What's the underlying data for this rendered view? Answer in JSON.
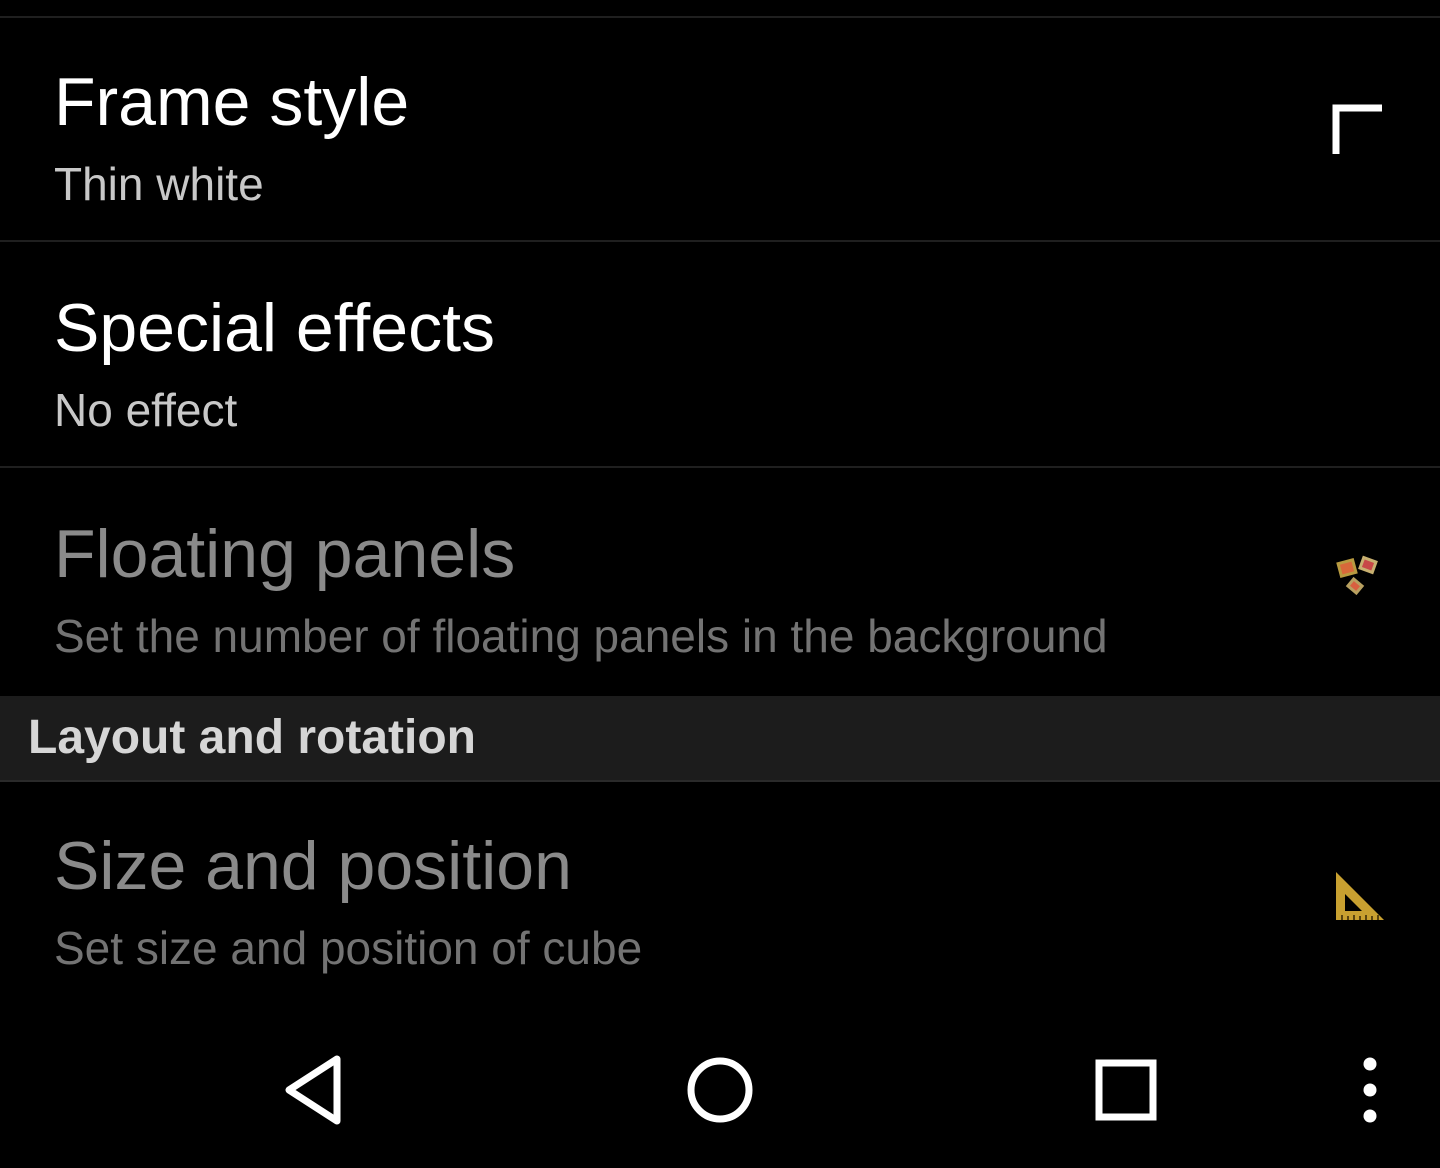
{
  "settings": {
    "items": [
      {
        "title": "Frame style",
        "summary": "Thin white",
        "icon": "frame-corner-icon",
        "enabled": true
      },
      {
        "title": "Special effects",
        "summary": "No effect",
        "icon": null,
        "enabled": true
      },
      {
        "title": "Floating panels",
        "summary": "Set the number of floating panels in the background",
        "icon": "floating-panels-icon",
        "enabled": false
      }
    ],
    "category": {
      "label": "Layout and rotation"
    },
    "items_after_category": [
      {
        "title": "Size and position",
        "summary": "Set size and position of cube",
        "icon": "set-square-ruler-icon",
        "enabled": false
      }
    ]
  },
  "navbar": {
    "buttons": [
      "back-icon",
      "home-icon",
      "recents-icon",
      "overflow-menu-icon"
    ]
  },
  "colors": {
    "background": "#000000",
    "category_background": "#1c1c1c",
    "title_enabled": "#ffffff",
    "title_disabled": "#8a8a8a",
    "icon_gold": "#c8a030"
  }
}
